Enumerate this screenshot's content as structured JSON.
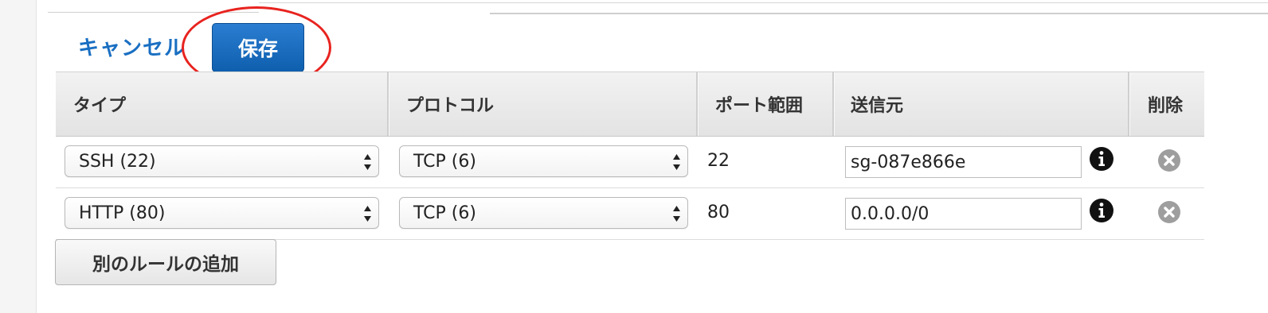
{
  "actions": {
    "cancel_label": "キャンセル",
    "save_label": "保存",
    "add_rule_label": "別のルールの追加"
  },
  "table": {
    "headers": [
      "タイプ",
      "プロトコル",
      "ポート範囲",
      "送信元",
      "削除"
    ],
    "rows": [
      {
        "type": "SSH (22)",
        "protocol": "TCP (6)",
        "port": "22",
        "source": "sg-087e866e"
      },
      {
        "type": "HTTP (80)",
        "protocol": "TCP (6)",
        "port": "80",
        "source": "0.0.0.0/0"
      }
    ]
  },
  "colors": {
    "primary_button": "#1565c0",
    "link": "#1a6fc2",
    "annotation": "#e8231f"
  },
  "icons": [
    "info-icon",
    "remove-icon",
    "select-arrows-icon"
  ]
}
